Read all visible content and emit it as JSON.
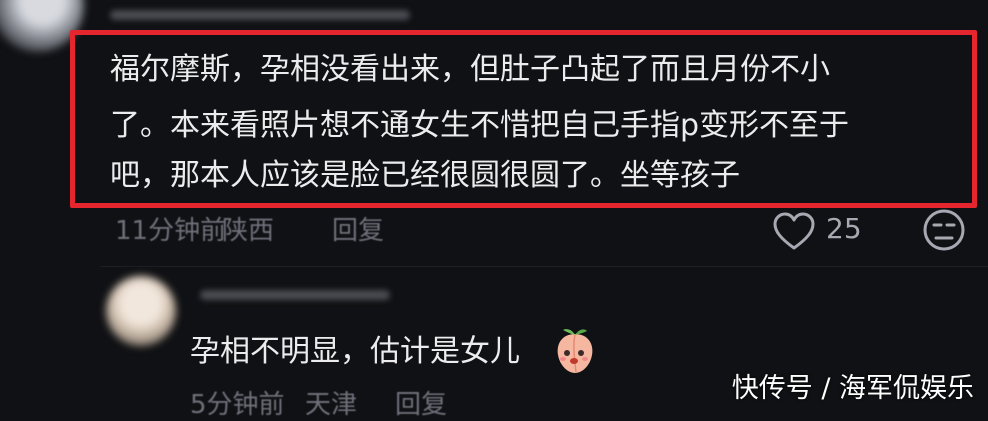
{
  "comment": {
    "lines": [
      "福尔摩斯，孕相没看出来，但肚子凸起了而且月份不小",
      "了。本来看照片想不通女生不惜把自己手指p变形不至于",
      "吧，那本人应该是脸已经很圆很圆了。坐等孩子"
    ],
    "time": "11分钟前",
    "region": "陕西",
    "reply_label": "回复",
    "like_count": "25",
    "highlight_color": "#e5262f"
  },
  "reply": {
    "text": "孕相不明显，估计是女儿",
    "emoji": "peach-face",
    "time": "5分钟前",
    "region": "天津",
    "reply_label": "回复"
  },
  "watermark": "快传号 / 海军侃娱乐",
  "colors": {
    "background": "#101114",
    "text": "#ececee",
    "meta": "#6e707a"
  }
}
